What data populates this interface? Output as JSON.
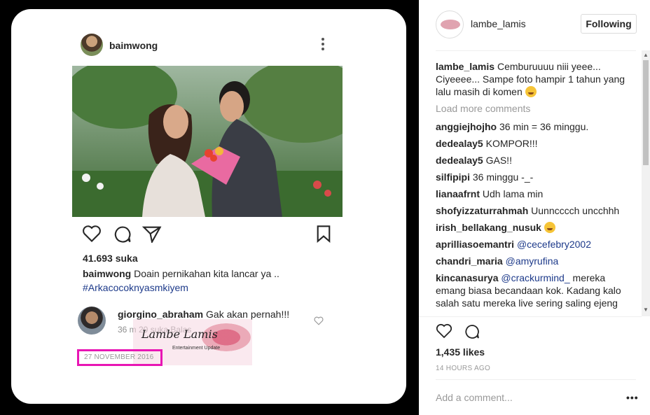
{
  "post_card": {
    "username": "baimwong",
    "likes": "41.693 suka",
    "caption_user": "baimwong",
    "caption_text": "Doain pernikahan kita lancar ya ..",
    "hashtag": "#Arkacocoknyasmkiyem",
    "comment": {
      "user": "giorgino_abraham",
      "text": "Gak akan pernah!!!",
      "meta": "36 m    20 suka   Balas"
    },
    "watermark_title": "Lambe Lamis",
    "watermark_sub": "Entertainment Update",
    "date": "27 NOVEMBER 2016"
  },
  "panel": {
    "username": "lambe_lamis",
    "follow_label": "Following",
    "caption": {
      "user": "lambe_lamis",
      "text": "Cemburuuuu niii yeee... Ciyeeee... Sampe foto hampir 1 tahun yang lalu masih di komen"
    },
    "load_more": "Load more comments",
    "comments": [
      {
        "user": "anggiejhojho",
        "text": "36 min = 36 minggu."
      },
      {
        "user": "dedealay5",
        "text": "KOMPOR!!!"
      },
      {
        "user": "dedealay5",
        "text": "GAS!!"
      },
      {
        "user": "silfipipi",
        "text": "36 minggu -_-"
      },
      {
        "user": "lianaafrnt",
        "text": "Udh lama min"
      },
      {
        "user": "shofyizzaturrahmah",
        "text": "Uunncccch uncchhh"
      },
      {
        "user": "irish_bellakang_nusuk",
        "text": ""
      },
      {
        "user": "aprilliasoemantri",
        "mention": "@cecefebry2002"
      },
      {
        "user": "chandri_maria",
        "mention": "@amyrufina"
      },
      {
        "user": "kincanasurya",
        "mention": "@crackurmind_",
        "text": " mereka emang biasa becandaan kok. Kadang kalo salah satu mereka live sering saling ejeng"
      }
    ],
    "likes": "1,435 likes",
    "time": "14 HOURS AGO",
    "add_comment_placeholder": "Add a comment...",
    "more_label": "•••"
  },
  "colors": {
    "hashtag": "#1d3a8a",
    "date_highlight": "#e816b4",
    "background_left": "#000000"
  },
  "icons": [
    "kebab-icon",
    "heart-icon",
    "comment-icon",
    "share-icon",
    "bookmark-icon",
    "emoji-icon"
  ]
}
